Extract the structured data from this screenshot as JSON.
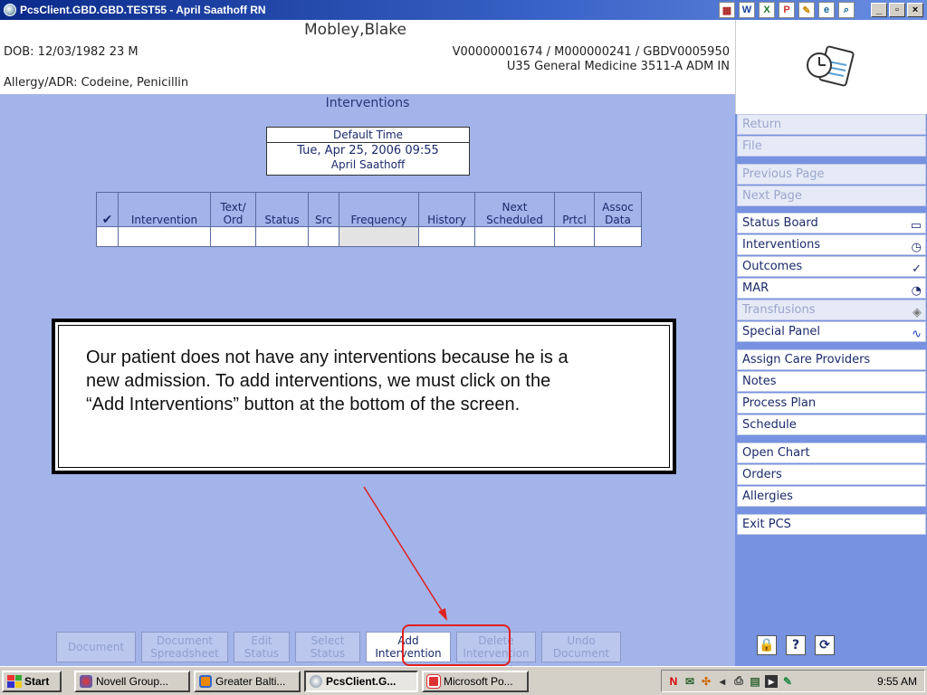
{
  "window": {
    "title": "PcsClient.GBD.GBD.TEST55 - April Saathoff RN",
    "toolbar_icons": [
      "chart-icon",
      "word-icon",
      "excel-icon",
      "powerpoint-icon",
      "tools-icon",
      "browser-icon",
      "search-icon"
    ],
    "controls": {
      "minimize": "_",
      "maximize": "▫",
      "close": "×"
    }
  },
  "patient": {
    "name": "Mobley,Blake",
    "dob": "DOB: 12/03/1982 23 M",
    "visit_ids": "V00000001674 / M000000241 / GBDV0005950",
    "location": "U35 General Medicine  3511-A  ADM IN",
    "allergy": "Allergy/ADR: Codeine, Penicillin"
  },
  "section_title": "Interventions",
  "default_time": {
    "label": "Default Time",
    "value": "Tue, Apr 25, 2006  09:55",
    "user": "April Saathoff"
  },
  "grid": {
    "check_header": "✔",
    "columns": [
      "Intervention",
      "Text/\nOrd",
      "Status",
      "Src",
      "Frequency",
      "History",
      "Next\nScheduled",
      "Prtcl",
      "Assoc\nData"
    ]
  },
  "callout": {
    "text": "Our patient does not have any interventions because he is a\n new admission. To add interventions, we must click on the\n “Add Interventions” button at the bottom of the screen."
  },
  "actions": [
    {
      "label": "Document",
      "enabled": false
    },
    {
      "label": "Document\nSpreadsheet",
      "enabled": false
    },
    {
      "label": "Edit\nStatus",
      "enabled": false
    },
    {
      "label": "Select\nStatus",
      "enabled": false
    },
    {
      "label": "Add\nIntervention",
      "enabled": true
    },
    {
      "label": "Delete\nIntervention",
      "enabled": false
    },
    {
      "label": "Undo\nDocument",
      "enabled": false
    }
  ],
  "nav": {
    "return": "Return",
    "file": "File",
    "previous_page": "Previous Page",
    "next_page": "Next Page",
    "status_board": "Status Board",
    "interventions": "Interventions",
    "outcomes": "Outcomes",
    "mar": "MAR",
    "transfusions": "Transfusions",
    "special_panel": "Special Panel",
    "assign_care_providers": "Assign Care Providers",
    "notes": "Notes",
    "process_plan": "Process Plan",
    "schedule": "Schedule",
    "open_chart": "Open Chart",
    "orders": "Orders",
    "allergies": "Allergies",
    "exit_pcs": "Exit PCS",
    "bottom_icons": {
      "lock": "🔒",
      "help": "?",
      "refresh": "⟳"
    }
  },
  "taskbar": {
    "start": "Start",
    "tasks": [
      {
        "label": "Novell Group...",
        "active": false
      },
      {
        "label": "Greater Balti...",
        "active": false
      },
      {
        "label": "PcsClient.G...",
        "active": true
      },
      {
        "label": "Microsoft Po...",
        "active": false
      }
    ],
    "clock": "9:55 AM"
  },
  "colors": {
    "background": "#a3b4ea",
    "right_panel": "#7692e0",
    "highlight": "#e02020",
    "title_bar": "#0a2a8a"
  }
}
